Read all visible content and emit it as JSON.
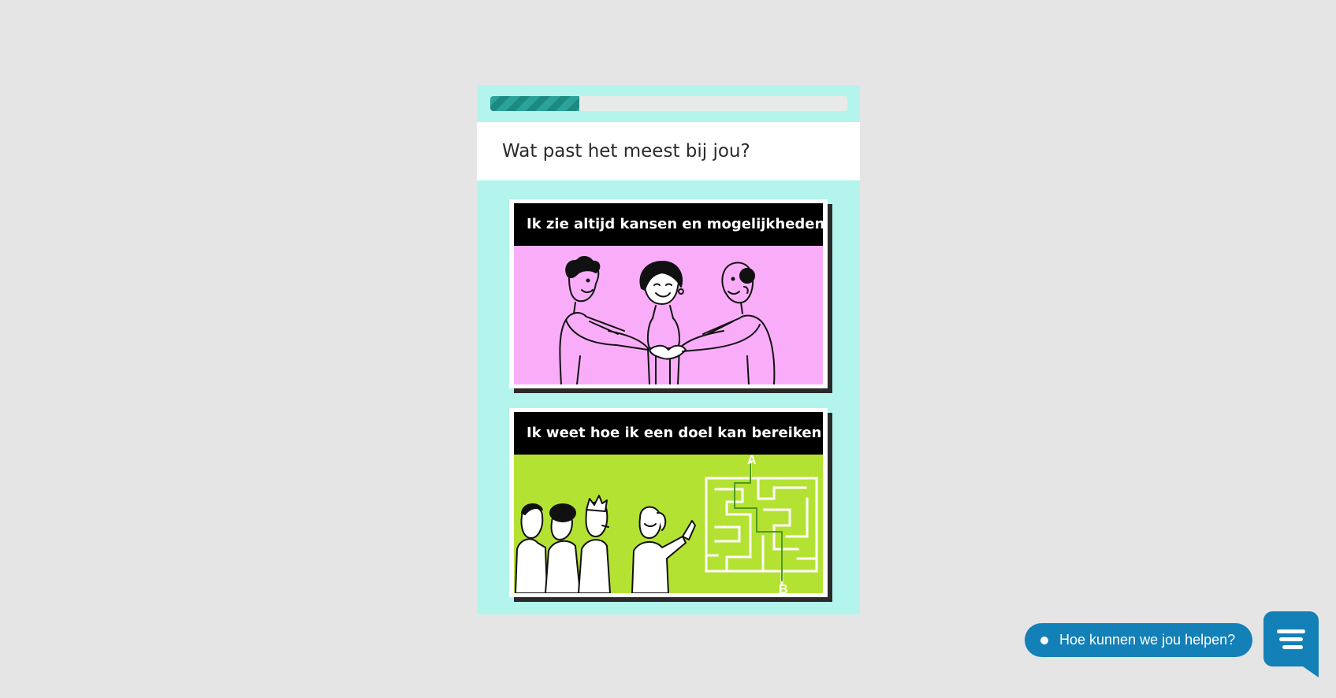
{
  "quiz": {
    "progress_percent": 25,
    "question": "Wat past het meest bij jou?",
    "options": [
      {
        "label": "Ik zie altijd kansen en mogelijkheden",
        "illustration": "people-shaking-hands",
        "background_color": "#f9adf9"
      },
      {
        "label": "Ik weet hoe ik een doel kan bereiken",
        "illustration": "group-with-maze",
        "background_color": "#b4e233"
      }
    ],
    "maze_labels": {
      "start": "A",
      "end": "B"
    }
  },
  "chat": {
    "prompt": "Hoe kunnen we jou helpen?",
    "icon": "chat-menu-icon",
    "color": "#1480b8"
  },
  "colors": {
    "page_background": "#e5e5e5",
    "card_background": "#b3f5ec",
    "progress_fill": "#2ba39a"
  }
}
